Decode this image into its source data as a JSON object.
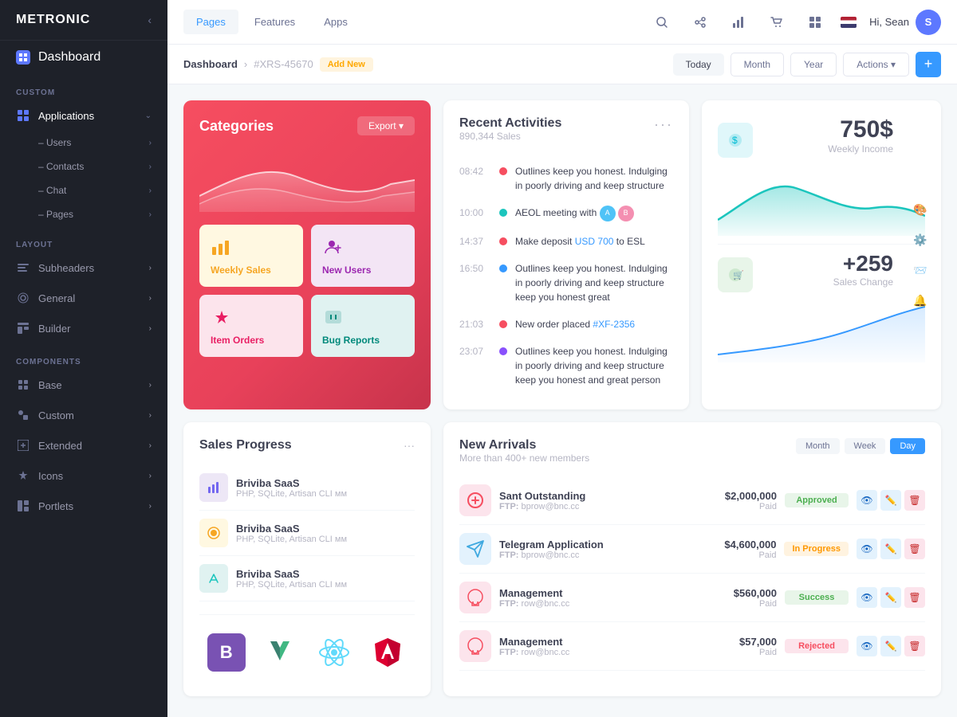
{
  "brand": {
    "name": "METRONIC"
  },
  "topnav": {
    "tabs": [
      {
        "id": "pages",
        "label": "Pages",
        "active": true
      },
      {
        "id": "features",
        "label": "Features",
        "active": false
      },
      {
        "id": "apps",
        "label": "Apps",
        "active": false
      }
    ],
    "user": {
      "greeting": "Hi, Sean",
      "avatar": "S"
    }
  },
  "subheader": {
    "breadcrumb_main": "Dashboard",
    "breadcrumb_id": "#XRS-45670",
    "breadcrumb_add": "Add New",
    "filters": [
      "Today",
      "Month",
      "Year",
      "Actions"
    ],
    "active_filter": "Today"
  },
  "sidebar": {
    "dashboard_label": "Dashboard",
    "sections": [
      {
        "id": "custom",
        "label": "CUSTOM",
        "items": [
          {
            "id": "applications",
            "label": "Applications",
            "has_children": true,
            "expanded": true
          },
          {
            "id": "users",
            "label": "Users",
            "sub": true
          },
          {
            "id": "contacts",
            "label": "Contacts",
            "sub": true
          },
          {
            "id": "chat",
            "label": "Chat",
            "sub": true
          },
          {
            "id": "pages",
            "label": "Pages",
            "sub": true
          }
        ]
      },
      {
        "id": "layout",
        "label": "LAYOUT",
        "items": [
          {
            "id": "subheaders",
            "label": "Subheaders"
          },
          {
            "id": "general",
            "label": "General"
          },
          {
            "id": "builder",
            "label": "Builder"
          }
        ]
      },
      {
        "id": "components",
        "label": "COMPONENTS",
        "items": [
          {
            "id": "base",
            "label": "Base"
          },
          {
            "id": "custom_comp",
            "label": "Custom"
          },
          {
            "id": "extended",
            "label": "Extended"
          },
          {
            "id": "icons",
            "label": "Icons"
          },
          {
            "id": "portlets",
            "label": "Portlets"
          }
        ]
      }
    ]
  },
  "categories": {
    "title": "Categories",
    "export_label": "Export",
    "tiles": [
      {
        "id": "weekly-sales",
        "label": "Weekly Sales",
        "color": "yellow"
      },
      {
        "id": "new-users",
        "label": "New Users",
        "color": "purple"
      },
      {
        "id": "item-orders",
        "label": "Item Orders",
        "color": "pink"
      },
      {
        "id": "bug-reports",
        "label": "Bug Reports",
        "color": "teal"
      }
    ]
  },
  "activities": {
    "title": "Recent Activities",
    "subtitle": "890,344 Sales",
    "items": [
      {
        "time": "08:42",
        "dot": "red",
        "text": "Outlines keep you honest. Indulging in poorly driving and keep structure"
      },
      {
        "time": "10:00",
        "dot": "teal",
        "text": "AEOL meeting with",
        "has_avatars": true
      },
      {
        "time": "14:37",
        "dot": "red",
        "text": "Make deposit",
        "highlight": "USD 700",
        "highlight_suffix": "to ESL"
      },
      {
        "time": "16:50",
        "dot": "blue",
        "text": "Outlines keep you honest. Indulging in poorly driving and keep structure keep you honest great"
      },
      {
        "time": "21:03",
        "dot": "red",
        "text": "New order placed",
        "highlight": "#XF-2356"
      },
      {
        "time": "23:07",
        "dot": "purple",
        "text": "Outlines keep you honest. Indulging in poorly driving and keep structure keep you honest and great person"
      }
    ]
  },
  "income": {
    "amount": "750$",
    "label": "Weekly Income",
    "sales_change": "+259",
    "sales_label": "Sales Change"
  },
  "sales_progress": {
    "title": "Sales Progress",
    "items": [
      {
        "name": "Briviba SaaS",
        "sub": "PHP, SQLite, Artisan CLI мм",
        "color": "#7367f0"
      },
      {
        "name": "Briviba SaaS",
        "sub": "PHP, SQLite, Artisan CLI мм",
        "color": "#f6a623"
      },
      {
        "name": "Briviba SaaS",
        "sub": "PHP, SQLite, Artisan CLI мм",
        "color": "#1bc5bd"
      }
    ]
  },
  "new_arrivals": {
    "title": "New Arrivals",
    "subtitle": "More than 400+ new members",
    "filters": [
      {
        "id": "month",
        "label": "Month"
      },
      {
        "id": "week",
        "label": "Week"
      },
      {
        "id": "day",
        "label": "Day",
        "active": true
      }
    ],
    "rows": [
      {
        "name": "Sant Outstanding",
        "sub": "FTP: bprow@bnc.cc",
        "amount": "$2,000,000",
        "paid": "Paid",
        "badge": "Approved",
        "badge_type": "approved",
        "logo_color": "#f64e60"
      },
      {
        "name": "Telegram Application",
        "sub": "FTP: bprow@bnc.cc",
        "amount": "$4,600,000",
        "paid": "Paid",
        "badge": "In Progress",
        "badge_type": "progress",
        "logo_color": "#40a9e0"
      },
      {
        "name": "Management",
        "sub": "row@bnc.cc",
        "amount": "$560,000",
        "paid": "Paid",
        "badge": "Success",
        "badge_type": "success",
        "logo_color": "#f64e60"
      },
      {
        "name": "Management",
        "sub": "row@bnc.cc",
        "amount": "$57,000",
        "paid": "Paid",
        "badge": "Rejected",
        "badge_type": "rejected",
        "logo_color": "#f64e60"
      }
    ]
  },
  "logos": [
    "B",
    "V",
    "R",
    "A"
  ]
}
